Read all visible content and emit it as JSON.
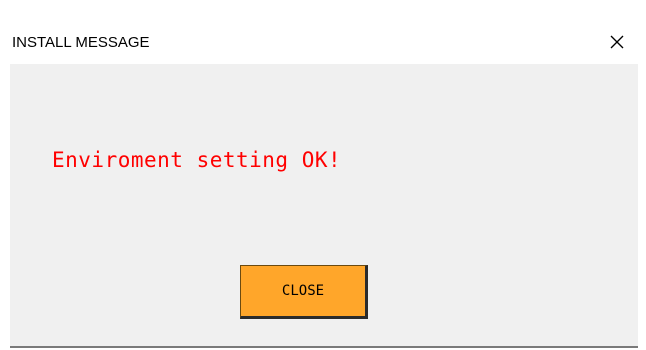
{
  "window": {
    "title": "INSTALL MESSAGE",
    "close_icon": "close-icon"
  },
  "main": {
    "message": "Enviroment setting OK!",
    "message_color": "#ff0000"
  },
  "footer": {
    "close_label": "CLOSE",
    "button_color": "#ffa62a"
  }
}
